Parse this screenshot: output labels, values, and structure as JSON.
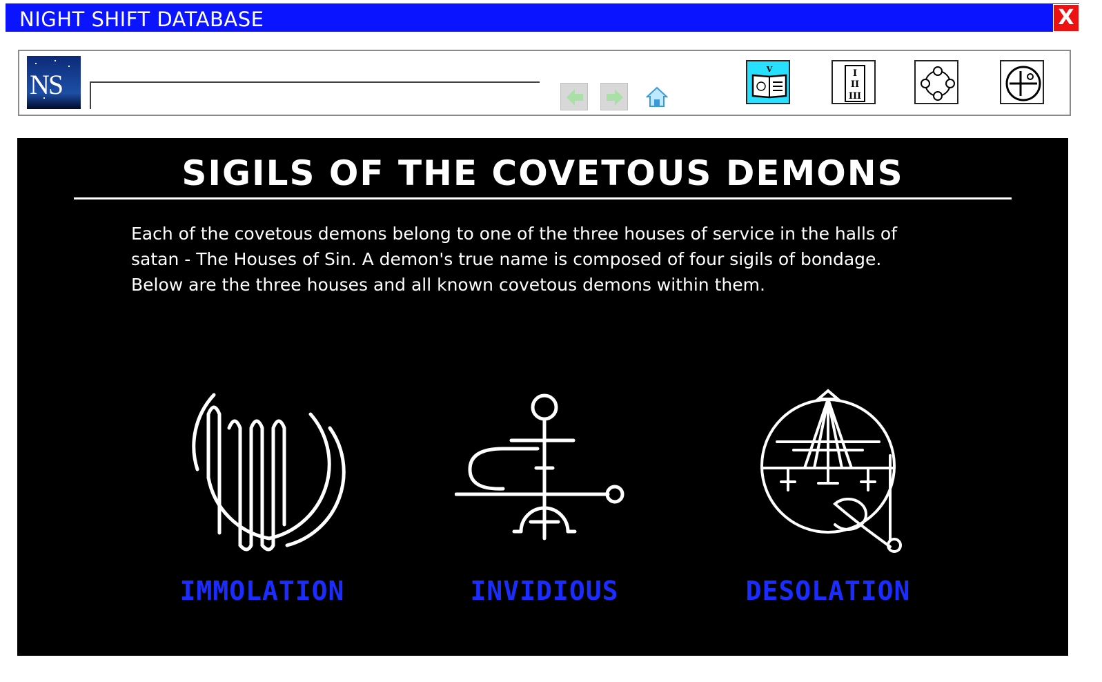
{
  "window": {
    "title": "NIGHT SHIFT DATABASE",
    "close_label": "X"
  },
  "toolbar": {
    "logo_text": "NS",
    "address_value": "",
    "buttons": [
      {
        "name": "back-arrow-icon"
      },
      {
        "name": "forward-arrow-icon"
      },
      {
        "name": "home-icon"
      },
      {
        "name": "book-icon",
        "active": true,
        "glyph": "V"
      },
      {
        "name": "roman-numerals-icon",
        "glyph": "I II III"
      },
      {
        "name": "circle-nodes-icon"
      },
      {
        "name": "sigil-circle-icon"
      }
    ],
    "active_color": "#27e0ff"
  },
  "page": {
    "heading": "SIGILS OF THE COVETOUS DEMONS",
    "intro_lines": [
      "Each of the covetous demons belong to one of the three houses of service in the halls of",
      "satan - The Houses of Sin. A demon's true name is composed of four sigils of bondage.",
      "Below are the three houses and all known covetous demons within them."
    ],
    "houses": [
      {
        "label": "IMMOLATION",
        "icon": "immolation-sigil-icon"
      },
      {
        "label": "INVIDIOUS",
        "icon": "invidious-sigil-icon"
      },
      {
        "label": "DESOLATION",
        "icon": "desolation-sigil-icon"
      }
    ],
    "label_color": "#1a2cff"
  }
}
